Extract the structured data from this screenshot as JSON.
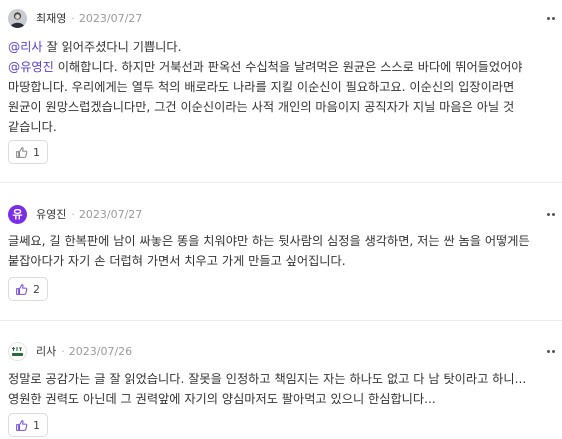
{
  "comments": [
    {
      "author": "최재영",
      "separator": "·",
      "date": "2023/07/27",
      "avatar_type": "photo",
      "lines": [
        [
          {
            "mention": "@리사"
          },
          {
            "text": " 잘 읽어주셨다니 기쁩니다."
          }
        ],
        [
          {
            "mention": "@유영진"
          },
          {
            "text": " 이해합니다. 하지만 거북선과 판옥선 수십척을 날려먹은 원균은 스스로 바다에 뛰어들었어야"
          }
        ],
        [
          {
            "text": "마땅합니다. 우리에게는 열두 척의 배로라도 나라를 지킬 이순신이 필요하고요. 이순신의 입장이라면"
          }
        ],
        [
          {
            "text": "원균이 원망스럽겠습니다만, 그건 이순신이라는 사적 개인의 마음이지 공직자가 지닐 마음은 아닐 것"
          }
        ],
        [
          {
            "text": "같습니다."
          }
        ]
      ],
      "likes": "1",
      "like_icon_color": "#888888"
    },
    {
      "author": "유영진",
      "separator": "·",
      "date": "2023/07/27",
      "avatar_type": "letter",
      "avatar_letter": "유",
      "avatar_color": "#7b2ee6",
      "lines": [
        [
          {
            "text": "글쎄요, 길 한복판에 남이 싸놓은 똥을 치워야만 하는 뒷사람의 심정을 생각하면, 저는 싼 놈을 어떻게든"
          }
        ],
        [
          {
            "text": "붙잡아다가 자기 손 더럽혀 가면서 치우고 가게 만들고 싶어집니다."
          }
        ]
      ],
      "likes": "2",
      "like_icon_color": "#7b4fe0"
    },
    {
      "author": "리사",
      "separator": "·",
      "date": "2023/07/26",
      "avatar_type": "logo",
      "avatar_text": "리사 ART",
      "lines": [
        [
          {
            "text": "정말로 공감가는 글 잘 읽었습니다. 잘못을 인정하고 책임지는 자는 하나도 없고 다 남 탓이라고 하니..."
          }
        ],
        [
          {
            "text": "영원한 권력도 아닌데 그 권력앞에 자기의 양심마저도 팔아먹고 있으니 한심합니다..."
          }
        ]
      ],
      "likes": "1",
      "like_icon_color": "#7b4fe0"
    }
  ]
}
